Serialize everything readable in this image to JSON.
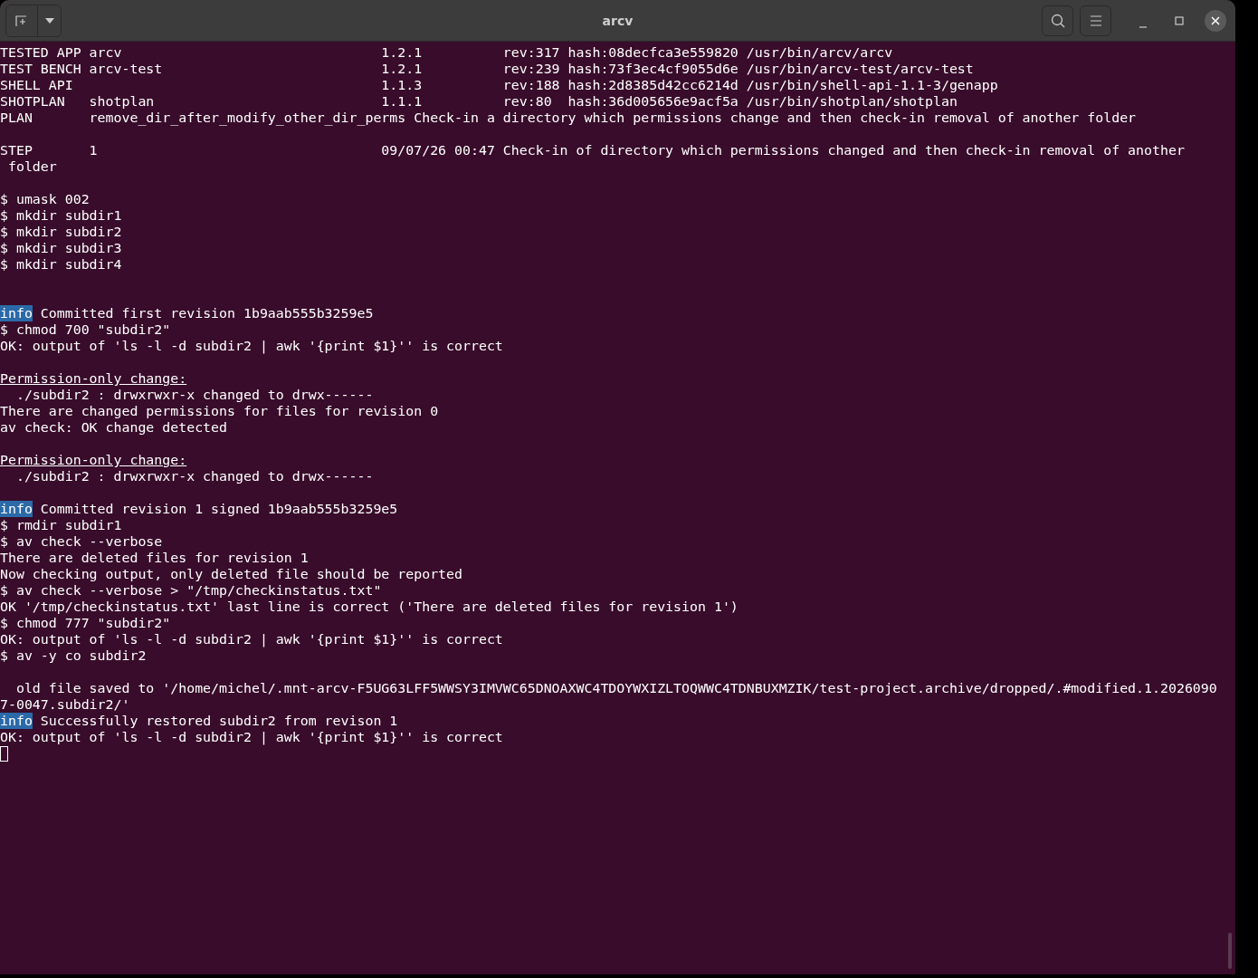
{
  "window": {
    "title": "arcv"
  },
  "lines": [
    {
      "kind": "text",
      "text": "TESTED APP arcv                                1.2.1          rev:317 hash:08decfca3e559820 /usr/bin/arcv/arcv"
    },
    {
      "kind": "text",
      "text": "TEST BENCH arcv-test                           1.2.1          rev:239 hash:73f3ec4cf9055d6e /usr/bin/arcv-test/arcv-test"
    },
    {
      "kind": "text",
      "text": "SHELL API                                      1.1.3          rev:188 hash:2d8385d42cc6214d /usr/bin/shell-api-1.1-3/genapp"
    },
    {
      "kind": "text",
      "text": "SHOTPLAN   shotplan                            1.1.1          rev:80  hash:36d005656e9acf5a /usr/bin/shotplan/shotplan"
    },
    {
      "kind": "text",
      "text": "PLAN       remove_dir_after_modify_other_dir_perms Check-in a directory which permissions change and then check-in removal of another folder"
    },
    {
      "kind": "blank"
    },
    {
      "kind": "text",
      "text": "STEP       1                                   09/07/26 00:47 Check-in of directory which permissions changed and then check-in removal of another"
    },
    {
      "kind": "text",
      "text": " folder"
    },
    {
      "kind": "blank"
    },
    {
      "kind": "text",
      "text": "$ umask 002"
    },
    {
      "kind": "text",
      "text": "$ mkdir subdir1"
    },
    {
      "kind": "text",
      "text": "$ mkdir subdir2"
    },
    {
      "kind": "text",
      "text": "$ mkdir subdir3"
    },
    {
      "kind": "text",
      "text": "$ mkdir subdir4"
    },
    {
      "kind": "blank"
    },
    {
      "kind": "blank"
    },
    {
      "kind": "info",
      "tag": "info",
      "text": "Committed first revision 1b9aab555b3259e5"
    },
    {
      "kind": "text",
      "text": "$ chmod 700 \"subdir2\""
    },
    {
      "kind": "text",
      "text": "OK: output of 'ls -l -d subdir2 | awk '{print $1}'' is correct"
    },
    {
      "kind": "blank"
    },
    {
      "kind": "heading",
      "text": "Permission-only change:"
    },
    {
      "kind": "text",
      "text": "  ./subdir2 : drwxrwxr-x changed to drwx------"
    },
    {
      "kind": "text",
      "text": "There are changed permissions for files for revision 0"
    },
    {
      "kind": "text",
      "text": "av check: OK change detected"
    },
    {
      "kind": "blank"
    },
    {
      "kind": "heading",
      "text": "Permission-only change:"
    },
    {
      "kind": "text",
      "text": "  ./subdir2 : drwxrwxr-x changed to drwx------"
    },
    {
      "kind": "blank"
    },
    {
      "kind": "info",
      "tag": "info",
      "text": "Committed revision 1 signed 1b9aab555b3259e5"
    },
    {
      "kind": "text",
      "text": "$ rmdir subdir1"
    },
    {
      "kind": "text",
      "text": "$ av check --verbose"
    },
    {
      "kind": "text",
      "text": "There are deleted files for revision 1"
    },
    {
      "kind": "text",
      "text": "Now checking output, only deleted file should be reported"
    },
    {
      "kind": "text",
      "text": "$ av check --verbose > \"/tmp/checkinstatus.txt\""
    },
    {
      "kind": "text",
      "text": "OK '/tmp/checkinstatus.txt' last line is correct ('There are deleted files for revision 1')"
    },
    {
      "kind": "text",
      "text": "$ chmod 777 \"subdir2\""
    },
    {
      "kind": "text",
      "text": "OK: output of 'ls -l -d subdir2 | awk '{print $1}'' is correct"
    },
    {
      "kind": "text",
      "text": "$ av -y co subdir2"
    },
    {
      "kind": "blank"
    },
    {
      "kind": "text",
      "text": "  old file saved to '/home/michel/.mnt-arcv-F5UG63LFF5WWSY3IMVWC65DNOAXWC4TDOYWXIZLTOQWWC4TDNBUXMZIK/test-project.archive/dropped/.#modified.1.2026090"
    },
    {
      "kind": "text",
      "text": "7-0047.subdir2/'"
    },
    {
      "kind": "info",
      "tag": "info",
      "text": "Successfully restored subdir2 from revison 1"
    },
    {
      "kind": "text",
      "text": "OK: output of 'ls -l -d subdir2 | awk '{print $1}'' is correct"
    },
    {
      "kind": "cursor"
    }
  ]
}
